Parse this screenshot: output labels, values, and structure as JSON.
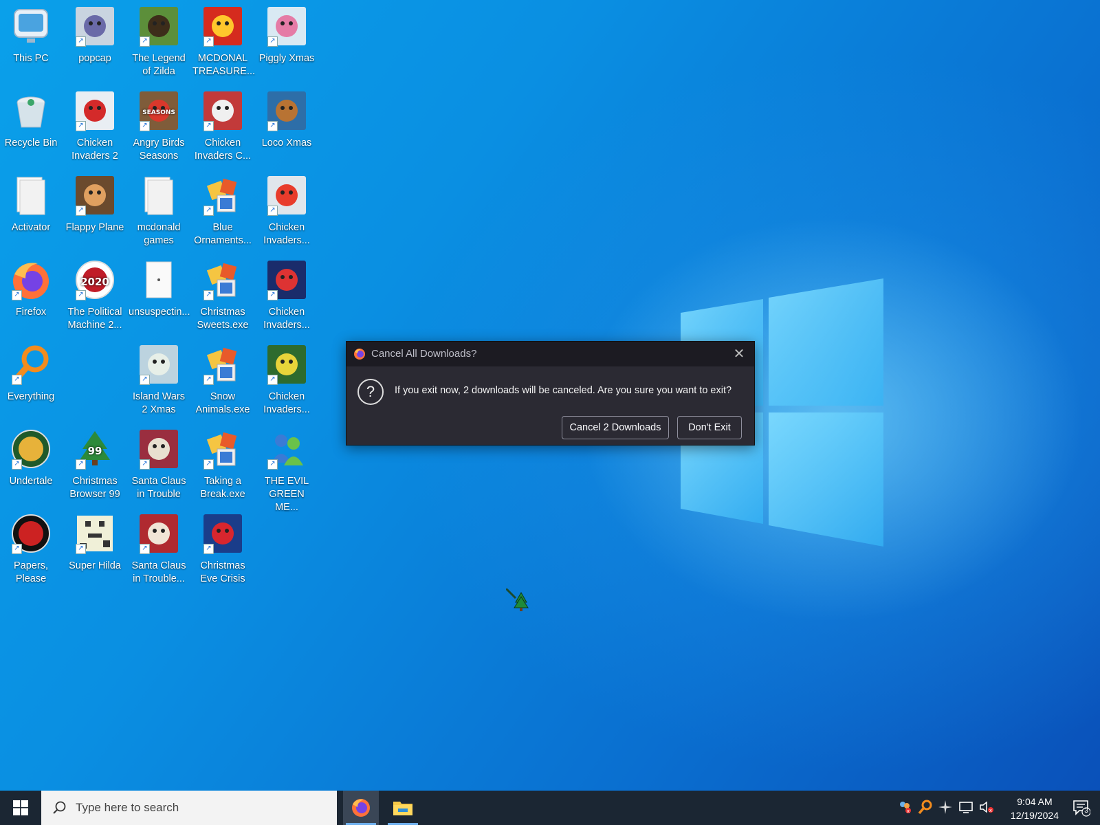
{
  "desktop": {
    "icons": [
      {
        "label": "This PC"
      },
      {
        "label": "popcap"
      },
      {
        "label": "The Legend of Zilda"
      },
      {
        "label": "MCDONAL TREASURE..."
      },
      {
        "label": "Piggly Xmas"
      },
      {
        "label": "Recycle Bin"
      },
      {
        "label": "Chicken Invaders 2"
      },
      {
        "label": "Angry Birds Seasons"
      },
      {
        "label": "Chicken Invaders C..."
      },
      {
        "label": "Loco Xmas"
      },
      {
        "label": "Activator"
      },
      {
        "label": "Flappy Plane"
      },
      {
        "label": "mcdonald games"
      },
      {
        "label": "Blue Ornaments..."
      },
      {
        "label": "Chicken Invaders..."
      },
      {
        "label": "Firefox"
      },
      {
        "label": "The Political Machine 2..."
      },
      {
        "label": "unsuspectin..."
      },
      {
        "label": "Christmas Sweets.exe"
      },
      {
        "label": "Chicken Invaders..."
      },
      {
        "label": "Everything"
      },
      {
        "label": "Island Wars 2 Xmas"
      },
      {
        "label": "Snow Animals.exe"
      },
      {
        "label": "Chicken Invaders..."
      },
      {
        "label": "Undertale"
      },
      {
        "label": "Christmas Browser 99"
      },
      {
        "label": "Santa Claus in Trouble"
      },
      {
        "label": "Taking a Break.exe"
      },
      {
        "label": "THE EVIL GREEN ME..."
      },
      {
        "label": "Papers, Please"
      },
      {
        "label": "Super Hilda"
      },
      {
        "label": "Santa Claus in Trouble..."
      },
      {
        "label": "Christmas Eve Crisis"
      }
    ],
    "icon_badges": {
      "pc2020": "2020",
      "browser99": "99",
      "seasons": "SEASONS"
    }
  },
  "dialog": {
    "title": "Cancel All Downloads?",
    "message": "If you exit now, 2 downloads will be canceled. Are you sure you want to exit?",
    "cancel_label": "Cancel 2 Downloads",
    "dont_exit_label": "Don't Exit",
    "close_glyph": "✕",
    "question_glyph": "?"
  },
  "taskbar": {
    "search_placeholder": "Type here to search",
    "time": "9:04 AM",
    "date": "12/19/2024",
    "notification_count": "3"
  },
  "colors": {
    "taskbar": "#1b2633",
    "dialog_bg": "#2b2a33",
    "accent": "#0a8fe2"
  }
}
